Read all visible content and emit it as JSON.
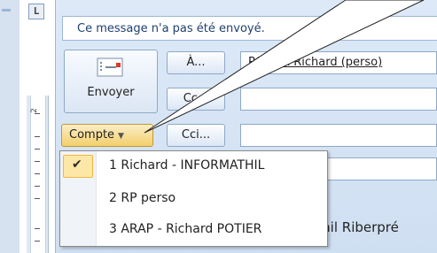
{
  "ruler": {
    "top_box": "L",
    "number": "2"
  },
  "info_bar": {
    "message": "Ce message n'a pas été envoyé."
  },
  "send": {
    "label": "Envoyer",
    "icon": "send-envelope-icon"
  },
  "fields": {
    "to_label": "À...",
    "to_value": "POTIER Richard (perso)",
    "cc_label": "Cc...",
    "bcc_label": "Cci..."
  },
  "account": {
    "label": "Compte"
  },
  "menu": {
    "items": [
      {
        "label": "1 Richard - INFORMATHIL",
        "checked": true
      },
      {
        "label": "2 RP perso",
        "checked": false
      },
      {
        "label": "3 ARAP - Richard POTIER",
        "checked": false
      }
    ]
  },
  "document": {
    "snippet": "Thil Riberpré"
  },
  "colors": {
    "window_bg": "#cfdff2",
    "highlight": "#f3cf6b"
  }
}
